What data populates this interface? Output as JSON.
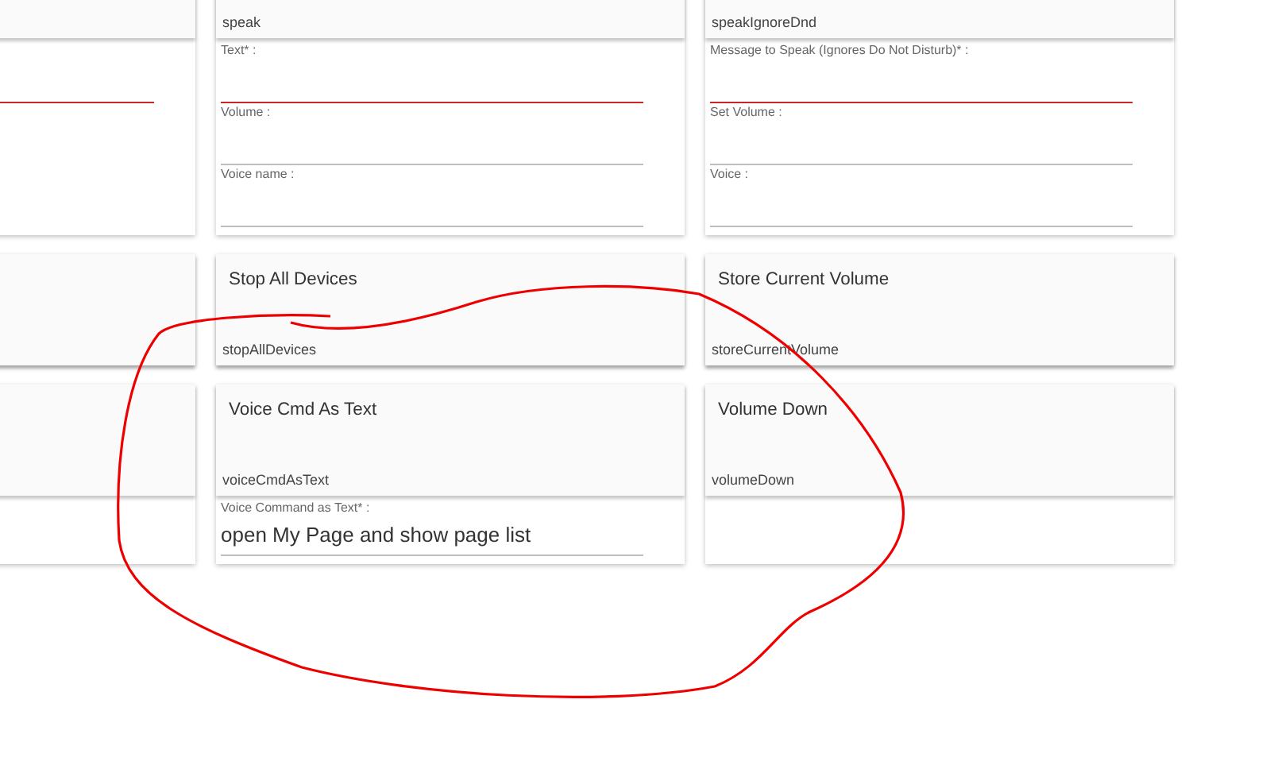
{
  "cards": [
    {
      "kind": "form",
      "fields": [
        {
          "error": true
        }
      ]
    },
    {
      "kind": "form",
      "command": "speak",
      "fields": [
        {
          "label": "Text* :",
          "error": true
        },
        {
          "label": "Volume :",
          "error": false
        },
        {
          "label": "Voice name :",
          "error": false
        }
      ]
    },
    {
      "kind": "form",
      "command": "speakIgnoreDnd",
      "fields": [
        {
          "label": "Message to Speak (Ignores Do Not Disturb)* :",
          "error": true
        },
        {
          "label": "Set Volume :",
          "error": false
        },
        {
          "label": "Voice :",
          "error": false
        }
      ]
    },
    {
      "kind": "plain"
    },
    {
      "kind": "plain",
      "title": "Stop All Devices",
      "command": "stopAllDevices"
    },
    {
      "kind": "plain",
      "title": "Store Current Volume",
      "command": "storeCurrentVolume"
    },
    {
      "kind": "form"
    },
    {
      "kind": "form",
      "title": "Voice Cmd As Text",
      "command": "voiceCmdAsText",
      "fields": [
        {
          "label": "Voice Command as Text* :",
          "value": "open My Page and show page list",
          "error": false
        }
      ]
    },
    {
      "kind": "form",
      "title": "Volume Down",
      "command": "volumeDown"
    }
  ]
}
